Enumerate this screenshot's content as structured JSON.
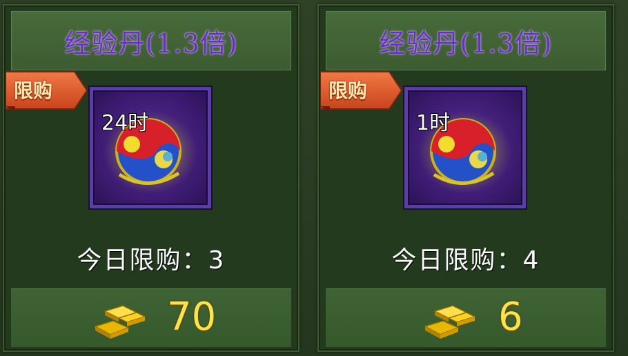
{
  "shop": {
    "items": [
      {
        "title": "经验丹(1.3倍)",
        "tag": "限购",
        "duration": "24时",
        "daily_limit": "今日限购：3",
        "price": "70",
        "icon": "yin-yang-orb-icon",
        "currency_icon": "gold-ingot-icon"
      },
      {
        "title": "经验丹(1.3倍)",
        "tag": "限购",
        "duration": "1时",
        "daily_limit": "今日限购：4",
        "price": "6",
        "icon": "yin-yang-orb-icon",
        "currency_icon": "gold-ingot-icon"
      }
    ]
  },
  "colors": {
    "title_purple": "#6b2cc9",
    "tag_orange": "#e8643a",
    "price_gold": "#ffe14a",
    "panel_green": "#233a1e"
  }
}
